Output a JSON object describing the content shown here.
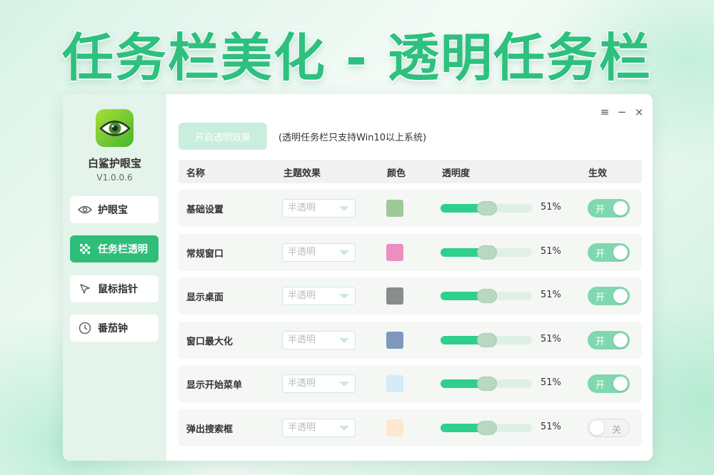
{
  "headline": "任务栏美化 - 透明任务栏",
  "app": {
    "name": "白鲨护眼宝",
    "version": "V1.0.0.6"
  },
  "window_controls": {
    "menu": "≡",
    "minimize": "−",
    "close": "×"
  },
  "nav": [
    {
      "label": "护眼宝",
      "icon": "eye-icon",
      "active": false
    },
    {
      "label": "任务栏透明",
      "icon": "checker-icon",
      "active": true
    },
    {
      "label": "鼠标指针",
      "icon": "cursor-icon",
      "active": false
    },
    {
      "label": "番茄钟",
      "icon": "clock-icon",
      "active": false
    }
  ],
  "toolbar": {
    "enable_label": "开启透明效果",
    "note": "(透明任务栏只支持Win10以上系统)"
  },
  "table": {
    "headers": [
      "名称",
      "主题效果",
      "颜色",
      "透明度",
      "生效"
    ],
    "rows": [
      {
        "name": "基础设置",
        "theme": "半透明",
        "color": "#9ec89a",
        "opacity_percent": 51,
        "opacity_label": "51%",
        "enabled": true,
        "toggle_label": "开"
      },
      {
        "name": "常规窗口",
        "theme": "半透明",
        "color": "#ea8fc0",
        "opacity_percent": 51,
        "opacity_label": "51%",
        "enabled": true,
        "toggle_label": "开"
      },
      {
        "name": "显示桌面",
        "theme": "半透明",
        "color": "#888c8c",
        "opacity_percent": 51,
        "opacity_label": "51%",
        "enabled": true,
        "toggle_label": "开"
      },
      {
        "name": "窗口最大化",
        "theme": "半透明",
        "color": "#7e97bd",
        "opacity_percent": 51,
        "opacity_label": "51%",
        "enabled": true,
        "toggle_label": "开"
      },
      {
        "name": "显示开始菜单",
        "theme": "半透明",
        "color": "#d4ebf8",
        "opacity_percent": 51,
        "opacity_label": "51%",
        "enabled": true,
        "toggle_label": "开"
      },
      {
        "name": "弹出搜索框",
        "theme": "半透明",
        "color": "#fbe8cf",
        "opacity_percent": 51,
        "opacity_label": "51%",
        "enabled": false,
        "toggle_label": "关"
      }
    ]
  },
  "colors": {
    "accent": "#2fbe7a",
    "sidebar_bg": "#e4f4ea"
  }
}
